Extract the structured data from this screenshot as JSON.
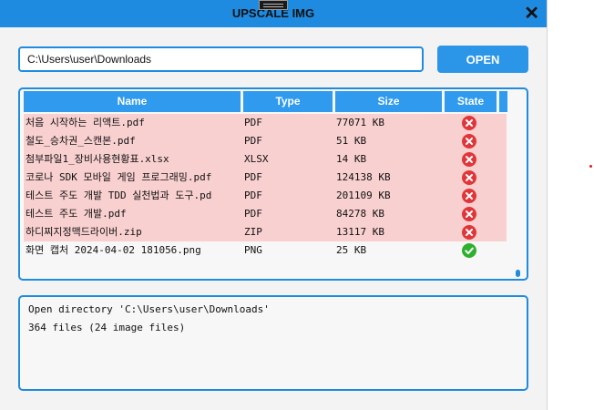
{
  "window": {
    "title": "UPSCALE IMG",
    "close_label": "✕"
  },
  "path": {
    "value": "C:\\Users\\user\\Downloads"
  },
  "open_button": {
    "label": "OPEN"
  },
  "table": {
    "headers": {
      "name": "Name",
      "type": "Type",
      "size": "Size",
      "state": "State"
    },
    "rows": [
      {
        "name": "처음 시작하는 리액트.pdf",
        "type": "PDF",
        "size": "77071 KB",
        "state": "fail"
      },
      {
        "name": "철도_승차권_스캔본.pdf",
        "type": "PDF",
        "size": "51 KB",
        "state": "fail"
      },
      {
        "name": "첨부파일1_장비사용현황표.xlsx",
        "type": "XLSX",
        "size": "14 KB",
        "state": "fail"
      },
      {
        "name": "코로나 SDK 모바일 게임 프로그래밍.pdf",
        "type": "PDF",
        "size": "124138 KB",
        "state": "fail"
      },
      {
        "name": "테스트 주도 개발 TDD 실천법과 도구.pd",
        "type": "PDF",
        "size": "201109 KB",
        "state": "fail"
      },
      {
        "name": "테스트 주도 개발.pdf",
        "type": "PDF",
        "size": "84278 KB",
        "state": "fail"
      },
      {
        "name": "하디찌지정맥드라이버.zip",
        "type": "ZIP",
        "size": "13117 KB",
        "state": "fail"
      },
      {
        "name": "화면 캡처 2024-04-02 181056.png",
        "type": "PNG",
        "size": "25 KB",
        "state": "ok"
      }
    ]
  },
  "log": {
    "lines": [
      "Open directory 'C:\\Users\\user\\Downloads'",
      "364 files (24 image files)"
    ]
  },
  "colors": {
    "accent": "#1e8be0",
    "fail_row": "#f9d0d0",
    "fail_icon": "#e0363a",
    "ok_icon": "#2eb02e"
  }
}
